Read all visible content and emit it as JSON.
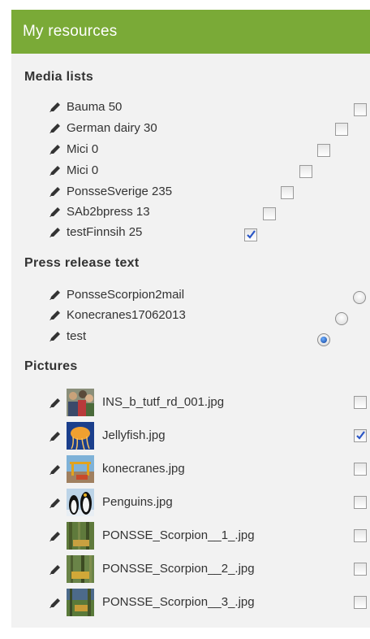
{
  "header": {
    "title": "My resources"
  },
  "media_lists": {
    "title": "Media lists",
    "items": [
      {
        "label": "Bauma 50",
        "checked": false
      },
      {
        "label": "German dairy 30",
        "checked": false
      },
      {
        "label": "Mici 0",
        "checked": false
      },
      {
        "label": "Mici 0",
        "checked": false
      },
      {
        "label": "PonsseSverige 235",
        "checked": false
      },
      {
        "label": "SAb2bpress 13",
        "checked": false
      },
      {
        "label": "testFinnsih 25",
        "checked": true
      }
    ]
  },
  "press_release": {
    "title": "Press release text",
    "items": [
      {
        "label": "PonsseScorpion2mail",
        "selected": false
      },
      {
        "label": "Konecranes17062013",
        "selected": false
      },
      {
        "label": "test",
        "selected": true
      }
    ]
  },
  "pictures": {
    "title": "Pictures",
    "items": [
      {
        "label": "INS_b_tutf_rd_001.jpg",
        "checked": false,
        "thumb": "crowd-photo"
      },
      {
        "label": "Jellyfish.jpg",
        "checked": true,
        "thumb": "jellyfish-photo"
      },
      {
        "label": "konecranes.jpg",
        "checked": false,
        "thumb": "crane-photo"
      },
      {
        "label": "Penguins.jpg",
        "checked": false,
        "thumb": "penguins-photo"
      },
      {
        "label": "PONSSE_Scorpion__1_.jpg",
        "checked": false,
        "thumb": "forest-machine-photo"
      },
      {
        "label": "PONSSE_Scorpion__2_.jpg",
        "checked": false,
        "thumb": "forest-machine-photo"
      },
      {
        "label": "PONSSE_Scorpion__3_.jpg",
        "checked": false,
        "thumb": "forest-machine-photo"
      }
    ]
  },
  "colors": {
    "header": "#7aaa37",
    "panel": "#f2f2f2",
    "check": "#2a56c6"
  }
}
